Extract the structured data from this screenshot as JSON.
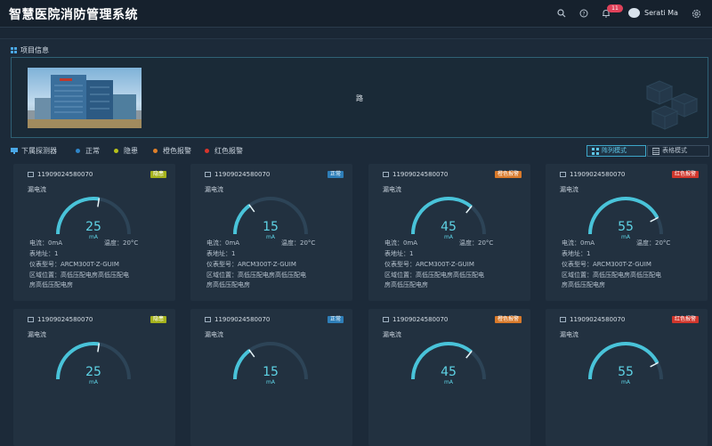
{
  "app": {
    "title": "智慧医院消防管理系统"
  },
  "header": {
    "notification_count": "11",
    "user_name": "Serati Ma",
    "icons": [
      "search-icon",
      "help-icon",
      "bell-icon",
      "avatar",
      "settings-icon"
    ]
  },
  "project": {
    "section_title": "项目信息",
    "value": "路"
  },
  "detectors": {
    "section_title": "下属探测器",
    "legend": [
      {
        "label": "正常",
        "color": "#2f86c9"
      },
      {
        "label": "隐患",
        "color": "#b8c21a"
      },
      {
        "label": "橙色报警",
        "color": "#e0802a"
      },
      {
        "label": "红色报警",
        "color": "#d8352c"
      }
    ],
    "modes": {
      "grid": "阵列模式",
      "list": "表格模式"
    }
  },
  "cards": [
    {
      "id": "11909024580070",
      "status": "隐患",
      "status_color": "#a5b21c",
      "sensor": "漏电流",
      "value": "25",
      "unit": "mA",
      "level": 0.55,
      "current_label": "电流：0mA",
      "temp_label": "温度：20°C",
      "address": "表地址：1",
      "model": "仪表型号：ARCM300T-Z-GUIM",
      "area_line1": "区域位置：高低压配电房高低压配电",
      "area_line2": "房高低压配电房"
    },
    {
      "id": "11909024580070",
      "status": "正常",
      "status_color": "#2e7eb8",
      "sensor": "漏电流",
      "value": "15",
      "unit": "mA",
      "level": 0.3,
      "current_label": "电流：0mA",
      "temp_label": "温度：20°C",
      "address": "表地址：1",
      "model": "仪表型号：ARCM300T-Z-GUIM",
      "area_line1": "区域位置：高低压配电房高低压配电",
      "area_line2": "房高低压配电房"
    },
    {
      "id": "11909024580070",
      "status": "橙色报警",
      "status_color": "#d8792a",
      "sensor": "漏电流",
      "value": "45",
      "unit": "mA",
      "level": 0.72,
      "current_label": "电流：0mA",
      "temp_label": "温度：20°C",
      "address": "表地址：1",
      "model": "仪表型号：ARCM300T-Z-GUIM",
      "area_line1": "区域位置：高低压配电房高低压配电",
      "area_line2": "房高低压配电房"
    },
    {
      "id": "11909024580070",
      "status": "红色报警",
      "status_color": "#d0362c",
      "sensor": "漏电流",
      "value": "55",
      "unit": "mA",
      "level": 0.85,
      "current_label": "电流：0mA",
      "temp_label": "温度：20°C",
      "address": "表地址：1",
      "model": "仪表型号：ARCM300T-Z-GUIM",
      "area_line1": "区域位置：高低压配电房高低压配电",
      "area_line2": "房高低压配电房"
    },
    {
      "id": "11909024580070",
      "status": "隐患",
      "status_color": "#a5b21c",
      "sensor": "漏电流",
      "value": "25",
      "unit": "mA",
      "level": 0.55
    },
    {
      "id": "11909024580070",
      "status": "正常",
      "status_color": "#2e7eb8",
      "sensor": "漏电流",
      "value": "15",
      "unit": "mA",
      "level": 0.3
    },
    {
      "id": "11909024580070",
      "status": "橙色报警",
      "status_color": "#d8792a",
      "sensor": "漏电流",
      "value": "45",
      "unit": "mA",
      "level": 0.72
    },
    {
      "id": "11909024580070",
      "status": "红色报警",
      "status_color": "#d0362c",
      "sensor": "漏电流",
      "value": "55",
      "unit": "mA",
      "level": 0.85
    }
  ]
}
